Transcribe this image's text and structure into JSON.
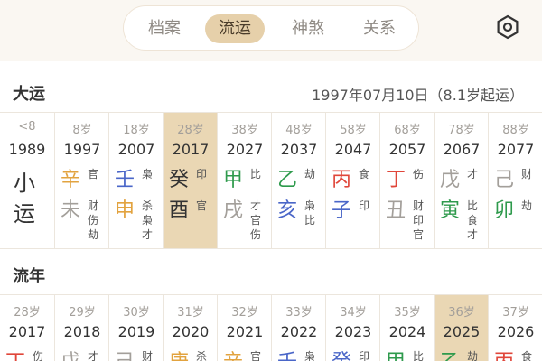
{
  "tabs": [
    "档案",
    "流运",
    "神煞",
    "关系"
  ],
  "active_tab": 1,
  "settings_icon": "hexagon-settings-icon",
  "dayun": {
    "title": "大运",
    "subtitle": "1997年07月10日（8.1岁起运）",
    "columns": [
      {
        "age": "<8",
        "year": "1989",
        "xiao": [
          "小",
          "运"
        ]
      },
      {
        "age": "8岁",
        "year": "1997",
        "stem": "辛",
        "stem_color": "#e2a33f",
        "stem_ten": "官",
        "branch": "未",
        "branch_color": "#a39f9a",
        "branch_ten": "财伤劫"
      },
      {
        "age": "18岁",
        "year": "2007",
        "stem": "壬",
        "stem_color": "#4a66c8",
        "stem_ten": "枭",
        "branch": "申",
        "branch_color": "#e2a33f",
        "branch_ten": "杀枭才"
      },
      {
        "age": "28岁",
        "year": "2017",
        "stem": "癸",
        "stem_color": "#333333",
        "stem_ten": "印",
        "branch": "酉",
        "branch_color": "#333333",
        "branch_ten": "官",
        "highlight": true
      },
      {
        "age": "38岁",
        "year": "2027",
        "stem": "甲",
        "stem_color": "#2e9a4c",
        "stem_ten": "比",
        "branch": "戌",
        "branch_color": "#a39f9a",
        "branch_ten": "才官伤"
      },
      {
        "age": "48岁",
        "year": "2037",
        "stem": "乙",
        "stem_color": "#2e9a4c",
        "stem_ten": "劫",
        "branch": "亥",
        "branch_color": "#4a66c8",
        "branch_ten": "枭比"
      },
      {
        "age": "58岁",
        "year": "2047",
        "stem": "丙",
        "stem_color": "#e0463a",
        "stem_ten": "食",
        "branch": "子",
        "branch_color": "#4a66c8",
        "branch_ten": "印"
      },
      {
        "age": "68岁",
        "year": "2057",
        "stem": "丁",
        "stem_color": "#e0463a",
        "stem_ten": "伤",
        "branch": "丑",
        "branch_color": "#a39f9a",
        "branch_ten": "财印官"
      },
      {
        "age": "78岁",
        "year": "2067",
        "stem": "戊",
        "stem_color": "#a39f9a",
        "stem_ten": "才",
        "branch": "寅",
        "branch_color": "#2e9a4c",
        "branch_ten": "比食才"
      },
      {
        "age": "88岁",
        "year": "2077",
        "stem": "己",
        "stem_color": "#a39f9a",
        "stem_ten": "财",
        "branch": "卯",
        "branch_color": "#2e9a4c",
        "branch_ten": "劫"
      }
    ]
  },
  "liunian": {
    "title": "流年",
    "columns": [
      {
        "age": "28岁",
        "year": "2017",
        "stem": "丁",
        "stem_color": "#e0463a",
        "stem_ten": "伤"
      },
      {
        "age": "29岁",
        "year": "2018",
        "stem": "戊",
        "stem_color": "#a39f9a",
        "stem_ten": "才"
      },
      {
        "age": "30岁",
        "year": "2019",
        "stem": "己",
        "stem_color": "#a39f9a",
        "stem_ten": "财"
      },
      {
        "age": "31岁",
        "year": "2020",
        "stem": "庚",
        "stem_color": "#e2a33f",
        "stem_ten": "杀"
      },
      {
        "age": "32岁",
        "year": "2021",
        "stem": "辛",
        "stem_color": "#e2a33f",
        "stem_ten": "官"
      },
      {
        "age": "33岁",
        "year": "2022",
        "stem": "壬",
        "stem_color": "#4a66c8",
        "stem_ten": "枭"
      },
      {
        "age": "34岁",
        "year": "2023",
        "stem": "癸",
        "stem_color": "#4a66c8",
        "stem_ten": "印"
      },
      {
        "age": "35岁",
        "year": "2024",
        "stem": "甲",
        "stem_color": "#2e9a4c",
        "stem_ten": "比"
      },
      {
        "age": "36岁",
        "year": "2025",
        "stem": "乙",
        "stem_color": "#2e9a4c",
        "stem_ten": "劫",
        "highlight": true
      },
      {
        "age": "37岁",
        "year": "2026",
        "stem": "丙",
        "stem_color": "#e0463a",
        "stem_ten": "食"
      }
    ]
  }
}
